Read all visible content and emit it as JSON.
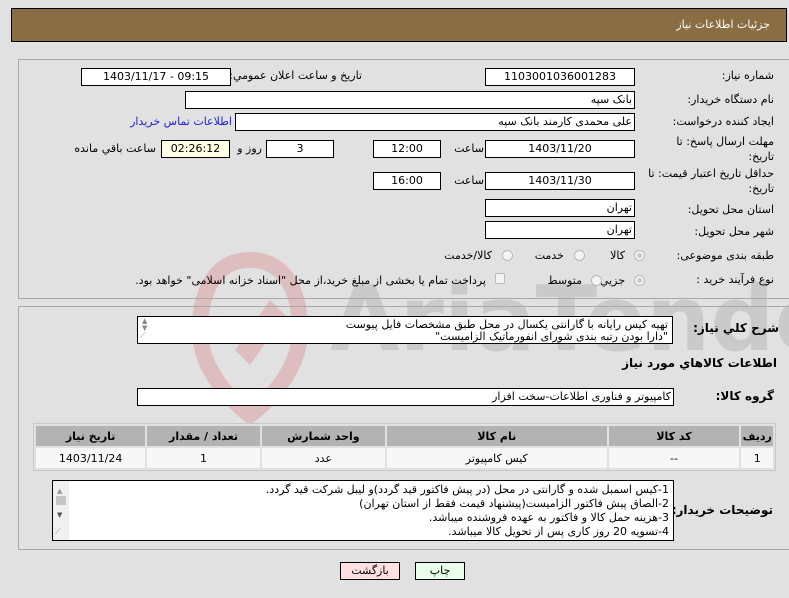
{
  "header": {
    "title": "جزئیات اطلاعات نیاز"
  },
  "form": {
    "need_number": {
      "label": "شماره نیاز:",
      "value": "1103001036001283"
    },
    "announce_datetime": {
      "label": "تاریخ و ساعت اعلان عمومي:",
      "value": "1403/11/17 - 09:15"
    },
    "buyer_org": {
      "label": "نام دستگاه خریدار:",
      "value": "بانک سپه"
    },
    "requester": {
      "label": "ایجاد کننده درخواست:",
      "value": "علی محمدی کارمند بانک سپه"
    },
    "contact_link": "اطلاعات تماس خریدار",
    "reply_deadline": {
      "label_line1": "مهلت ارسال پاسخ: تا",
      "label_line2": "تاریخ:",
      "date": "1403/11/20",
      "time_label": "ساعت",
      "time": "12:00",
      "days": "3",
      "days_label": "روز و",
      "remaining": "02:26:12",
      "remaining_label": "ساعت باقي مانده"
    },
    "price_validity": {
      "label_line1": "حداقل تاریخ اعتبار قیمت: تا",
      "label_line2": "تاریخ:",
      "date": "1403/11/30",
      "time_label": "ساعت",
      "time": "16:00"
    },
    "province": {
      "label": "استان محل تحویل:",
      "value": "تهران"
    },
    "city": {
      "label": "شهر محل تحویل:",
      "value": "تهران"
    },
    "category": {
      "label": "طبقه بندی موضوعی:",
      "options": [
        "کالا",
        "خدمت",
        "کالا/خدمت"
      ],
      "selected": "کالا"
    },
    "process_type": {
      "label": "نوع فرآیند خرید :",
      "options": [
        "جزیي",
        "متوسط"
      ],
      "selected": "جزیي",
      "treasury_checkbox_label": "پرداخت تمام یا بخشی از مبلغ خرید،از محل \"اسناد خزانه اسلامی\" خواهد بود.",
      "treasury_checked": false
    }
  },
  "description": {
    "label": "شرح کلي نیاز:",
    "lines": [
      "تهیه کیس رایانه با گارانتی یکسال در محل طبق مشخصات فایل پیوست",
      "\"دارا بودن رتبه بندی شورای انفورماتیک الزامیست\""
    ]
  },
  "items_section": {
    "title": "اطلاعات کالاهاي مورد نیاز",
    "group_label": "گروه کالا:",
    "group_value": "کامپیوتر و فناوری اطلاعات-سخت افزار",
    "columns": [
      "ردیف",
      "کد کالا",
      "نام کالا",
      "واحد شمارش",
      "تعداد / مقدار",
      "تاریخ نیاز"
    ],
    "rows": [
      [
        "1",
        "--",
        "کیس کامپیوتر",
        "عدد",
        "1",
        "1403/11/24"
      ]
    ]
  },
  "buyer_notes": {
    "label": "توضیحات خریدار:",
    "lines": [
      "1-کیس اسمبل شده و گارانتی در محل (در پیش فاکتور قید گردد)و لیبل شرکت قید گردد.",
      "2-الصاق پیش فاکتور الزامیست(پیشنهاد قیمت فقط از استان تهران)",
      "3-هزینه حمل کالا و فاکتور به عهده فروشنده میباشد.",
      "4-تسویه 20 روز کاری پس از تحویل کالا میباشد."
    ]
  },
  "buttons": {
    "print": "چاپ",
    "back": "بازگشت"
  },
  "colors": {
    "header_bg": "#8b6d43",
    "print_bg": "#eaffea",
    "back_bg": "#ffe0e0",
    "link": "#2222cc"
  }
}
